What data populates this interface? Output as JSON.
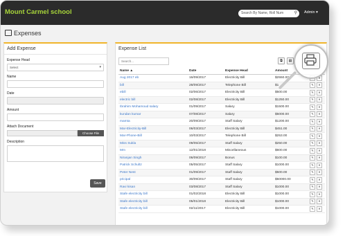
{
  "app": {
    "brand": "Mount Carmel school",
    "search_placeholder": "Search By Name, Roll Num",
    "admin_label": "Admin ▾"
  },
  "page": {
    "title": "Expenses"
  },
  "add_form": {
    "title": "Add Expense",
    "expense_head_label": "Expense Head",
    "expense_head_value": "Select",
    "name_label": "Name",
    "date_label": "Date",
    "amount_label": "Amount",
    "attach_label": "Attach Document",
    "choose_file": "Choose File",
    "description_label": "Description",
    "save_label": "Save"
  },
  "list": {
    "title": "Expense List",
    "search_placeholder": "Search...",
    "columns": [
      "Name",
      "Date",
      "Expense Head",
      "Amount"
    ],
    "rows": [
      [
        "Aug 2017 eb",
        "16/09/2017",
        "Electricity Bill",
        "$2550.00"
      ],
      [
        "bill",
        "28/09/2017",
        "Telephone Bill",
        "$1"
      ],
      [
        "ebill",
        "02/06/2017",
        "Electricity Bill",
        "$500.00"
      ],
      [
        "electric bill",
        "02/08/2017",
        "Electricity Bill",
        "$1250.00"
      ],
      [
        "Ibrahim Mohamoud salary",
        "01/09/2017",
        "Salary",
        "$1500.00"
      ],
      [
        "kundan kumar",
        "07/08/2017",
        "Salary",
        "$5000.00"
      ],
      [
        "mamta",
        "20/09/2017",
        "Staff Salary",
        "$1200.00"
      ],
      [
        "Mar-Electricity-Bill",
        "06/03/2017",
        "Electricity Bill",
        "$451.00"
      ],
      [
        "Mar-Phone-Bill",
        "10/03/2017",
        "Telephone Bill",
        "$253.00"
      ],
      [
        "Miss Sukla",
        "09/05/2017",
        "Staff Salary",
        "$250.00"
      ],
      [
        "Mm",
        "12/01/2018",
        "Miscellaneous",
        "$600.00"
      ],
      [
        "Niranjan Singh",
        "06/09/2017",
        "Bonus",
        "$100.00"
      ],
      [
        "Patrick Schultz",
        "05/05/2017",
        "Staff Salary",
        "$1000.00"
      ],
      [
        "Peter Nest",
        "01/09/2017",
        "Staff Salary",
        "$500.00"
      ],
      [
        "pricipal",
        "30/09/2017",
        "Staff Salary",
        "$50000.00"
      ],
      [
        "Ravi kisan",
        "03/08/2017",
        "Staff Salary",
        "$1000.00"
      ],
      [
        "Stafe electricity bill",
        "01/02/2018",
        "Electricity Bill",
        "$1000.00"
      ],
      [
        "Stafe electricity bill",
        "05/01/2018",
        "Electricity Bill",
        "$1000.00"
      ],
      [
        "Stafe electricity bill",
        "02/11/2017",
        "Electricity Bill",
        "$1000.00"
      ]
    ]
  }
}
